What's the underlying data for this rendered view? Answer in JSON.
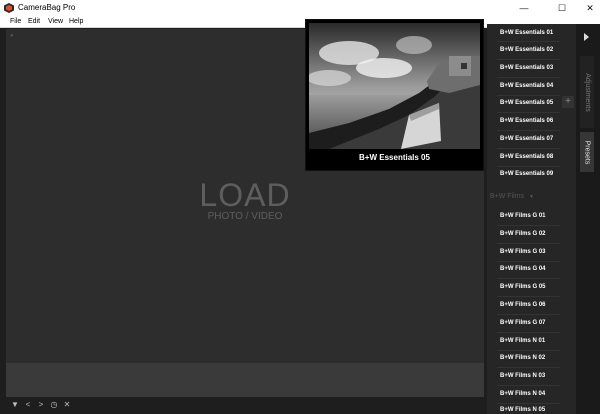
{
  "window": {
    "title": "CameraBag Pro",
    "minimize_glyph": "—",
    "maximize_glyph": "☐",
    "close_glyph": "✕"
  },
  "menu": {
    "items": [
      "File",
      "Edit",
      "View",
      "Help"
    ]
  },
  "canvas": {
    "load_title": "LOAD",
    "load_subtitle": "PHOTO / VIDEO"
  },
  "preview": {
    "label": "B+W Essentials 05"
  },
  "presets": {
    "essentials": [
      "B+W Essentials 01",
      "B+W Essentials 02",
      "B+W Essentials 03",
      "B+W Essentials 04",
      "B+W Essentials 05",
      "B+W Essentials 06",
      "B+W Essentials 07",
      "B+W Essentials 08",
      "B+W Essentials 09"
    ],
    "films_group": "B+W Films",
    "films": [
      "B+W Films G 01",
      "B+W Films G 02",
      "B+W Films G 03",
      "B+W Films G 04",
      "B+W Films G 05",
      "B+W Films G 06",
      "B+W Films G 07",
      "B+W Films N 01",
      "B+W Films N 02",
      "B+W Films N 03",
      "B+W Films N 04",
      "B+W Films N 05"
    ],
    "add_glyph": "+"
  },
  "tabs": {
    "adjustments": "Adjustments",
    "presets": "Presets"
  },
  "bottom_bar": {
    "icons": [
      "filter-icon",
      "prev-icon",
      "next-icon",
      "timer-icon",
      "close-icon"
    ],
    "glyphs": [
      "▼",
      "<",
      ">",
      "◷",
      "✕"
    ]
  },
  "colors": {
    "app_background": "#1e1e1e",
    "canvas": "#2d2d2d",
    "panel": "#262626",
    "text_primary": "#ffffff",
    "text_muted": "#5e5e5e"
  }
}
